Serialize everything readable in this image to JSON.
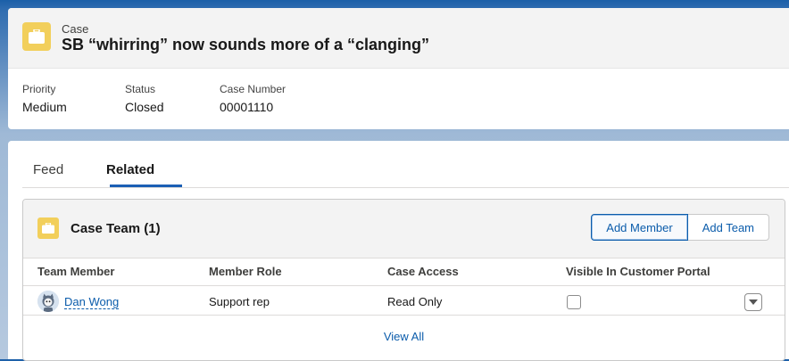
{
  "record": {
    "object_label": "Case",
    "title": "SB “whirring” now sounds more of a “clanging”",
    "icon": "briefcase-icon",
    "fields": [
      {
        "label": "Priority",
        "value": "Medium"
      },
      {
        "label": "Status",
        "value": "Closed"
      },
      {
        "label": "Case Number",
        "value": "00001110"
      }
    ]
  },
  "tabs": [
    {
      "label": "Feed",
      "active": false
    },
    {
      "label": "Related",
      "active": true
    }
  ],
  "case_team": {
    "title": "Case Team (1)",
    "icon": "briefcase-icon",
    "buttons": {
      "add_member": "Add Member",
      "add_team": "Add Team"
    },
    "columns": [
      "Team Member",
      "Member Role",
      "Case Access",
      "Visible In Customer Portal"
    ],
    "rows": [
      {
        "member": "Dan Wong",
        "role": "Support rep",
        "access": "Read Only",
        "visible_in_portal": false
      }
    ],
    "view_all": "View All"
  },
  "colors": {
    "accent": "#0b5cab",
    "icon_bg": "#f2cf5b",
    "brand_blue": "#1b5fa8"
  }
}
